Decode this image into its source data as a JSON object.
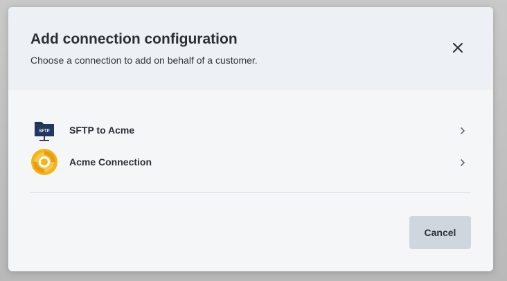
{
  "dialog": {
    "title": "Add connection configuration",
    "subtitle": "Choose a connection to add on behalf of a customer.",
    "close_icon": "close-icon"
  },
  "connections": [
    {
      "label": "SFTP to Acme",
      "icon": "sftp-folder-icon",
      "icon_text": "SFTP",
      "icon_color": "#1f3358",
      "chevron": "chevron-right-icon"
    },
    {
      "label": "Acme Connection",
      "icon": "acme-logo-icon",
      "icon_color": "#f3b41a",
      "chevron": "chevron-right-icon"
    }
  ],
  "footer": {
    "cancel_label": "Cancel"
  },
  "colors": {
    "header_bg": "#edf0f4",
    "body_bg": "#f5f6f8",
    "button_bg": "#cfd6de",
    "text": "#2a2f36"
  }
}
